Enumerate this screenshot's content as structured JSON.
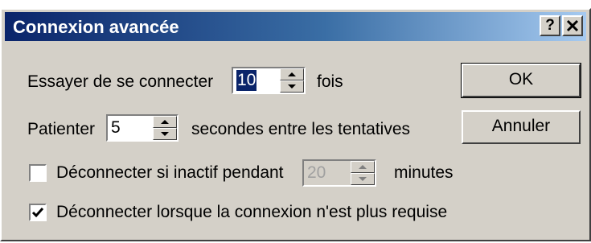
{
  "window": {
    "title": "Connexion avancée",
    "help_label": "?",
    "close_label": "✕"
  },
  "retry": {
    "label": "Essayer de se connecter",
    "value": "10",
    "suffix": "fois"
  },
  "wait": {
    "label": "Patienter",
    "value": "5",
    "suffix": "secondes entre les tentatives"
  },
  "idle_disconnect": {
    "label": "Déconnecter si inactif pendant",
    "checked": false,
    "value": "20",
    "suffix": "minutes"
  },
  "auto_disconnect": {
    "label": "Déconnecter lorsque la connexion n'est plus requise",
    "checked": true
  },
  "buttons": {
    "ok": "OK",
    "cancel": "Annuler"
  },
  "colors": {
    "titlebar_start": "#0a246a",
    "titlebar_end": "#a6caf0",
    "face": "#d4d0c8"
  }
}
